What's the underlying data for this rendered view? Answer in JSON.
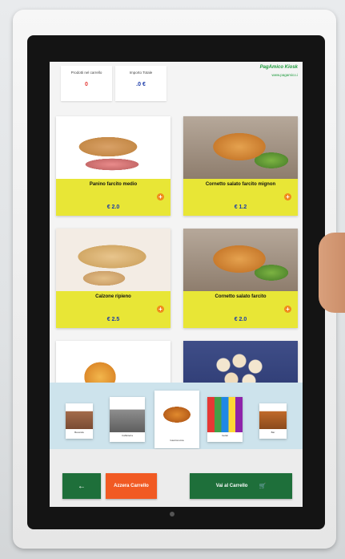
{
  "header": {
    "products_label": "Prodotti nel carrello",
    "products_count": "0",
    "total_label": "Importo Totale",
    "total_value": ".0 €",
    "brand_name": "PagAmico Kiosk",
    "brand_url": "www.pagamico.i"
  },
  "products": [
    {
      "name": "Panino farcito medio",
      "price": "€ 2.0"
    },
    {
      "name": "Cornetto salato farcito mignon",
      "price": "€ 1.2"
    },
    {
      "name": "Calzone ripieno",
      "price": "€ 2.5"
    },
    {
      "name": "Cornetto salato farcito",
      "price": "€ 2.0"
    }
  ],
  "categories": [
    {
      "label": "Bevande"
    },
    {
      "label": "Caffetteria"
    },
    {
      "label": "Gastronomia"
    },
    {
      "label": "Gelati"
    },
    {
      "label": "Bar"
    }
  ],
  "buttons": {
    "back": "←",
    "clear_cart": "Azzera Carrello",
    "go_cart": "Vai al Carrello",
    "cart_icon": "🛒"
  },
  "colors": {
    "accent_green": "#1e6f3a",
    "accent_orange": "#f15a23",
    "card_band": "#e8e636",
    "price_blue": "#1a3aa8"
  }
}
